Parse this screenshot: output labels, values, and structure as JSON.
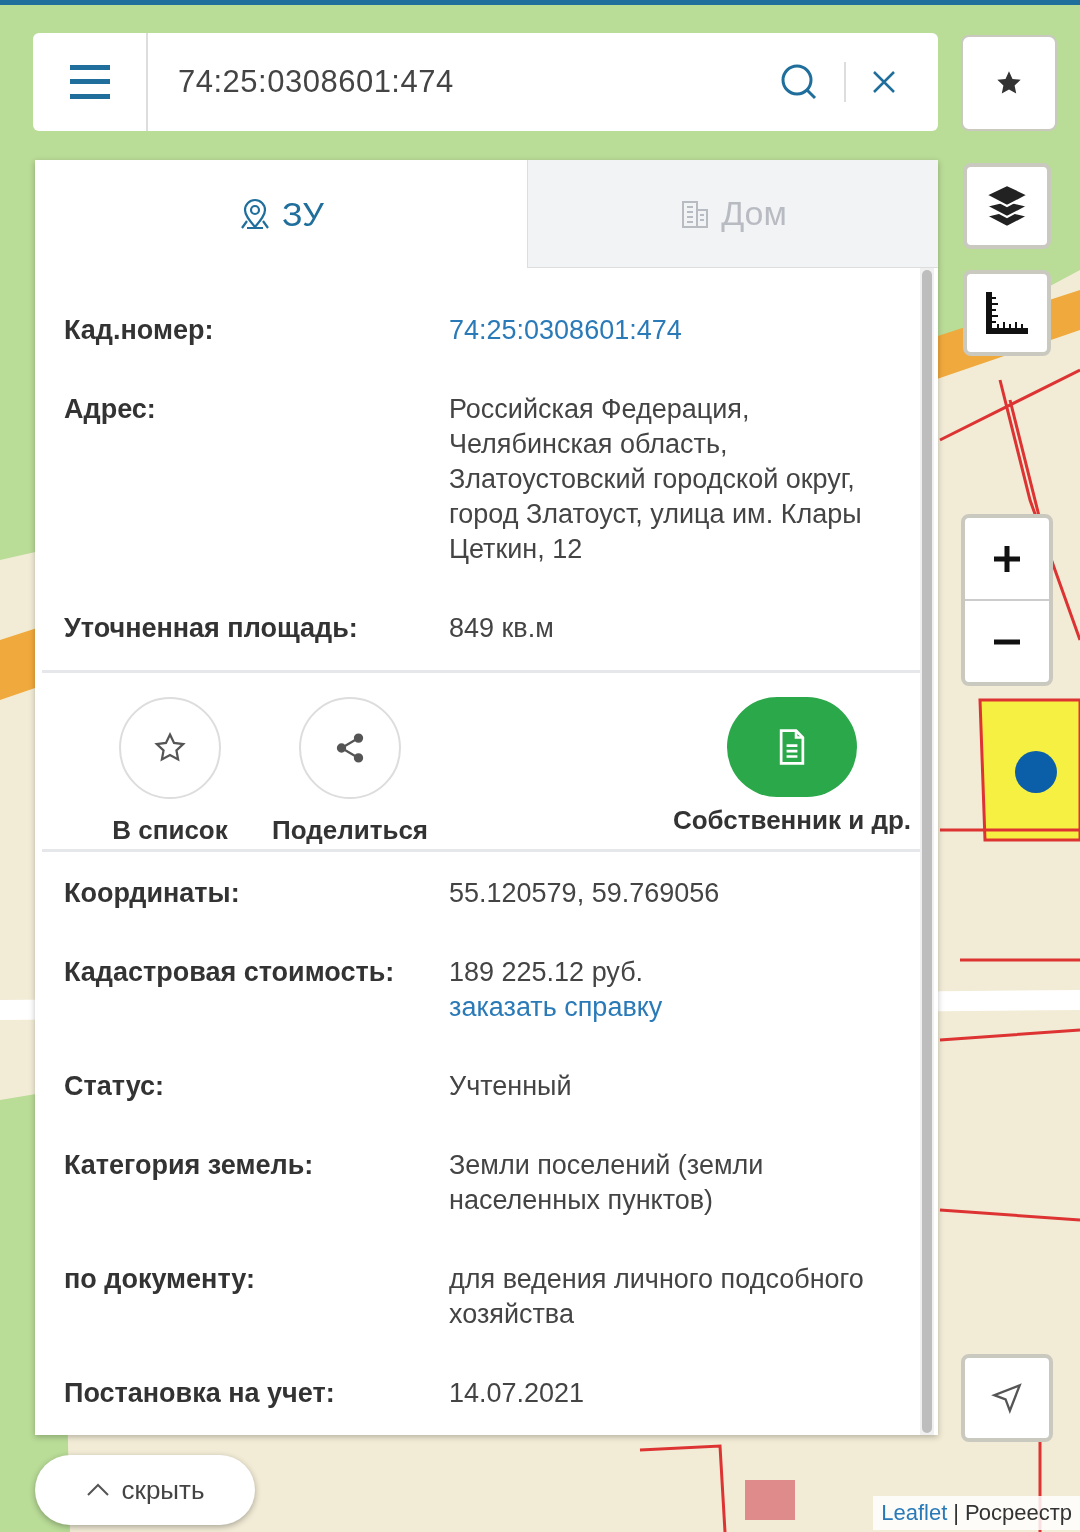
{
  "search": {
    "value": "74:25:0308601:474"
  },
  "tabs": [
    {
      "label": "ЗУ",
      "selected": true,
      "kind": "pin"
    },
    {
      "label": "Дом",
      "selected": false,
      "kind": "building"
    }
  ],
  "info_top": [
    {
      "label": "Кад.номер:",
      "value": "74:25:0308601:474",
      "kind": "link"
    },
    {
      "label": "Адрес:",
      "value": "Российская Федерация, Челябинская область, Златоустовский городской округ, город Златоуст, улица им. Клары Цеткин, 12",
      "kind": "text"
    },
    {
      "label": "Уточненная площадь:",
      "value": "849 кв.м",
      "kind": "text"
    }
  ],
  "actions": [
    {
      "label": "В список",
      "kind": "favorite"
    },
    {
      "label": "Поделиться",
      "kind": "share"
    },
    {
      "label": "Собственник и др.",
      "kind": "owner"
    }
  ],
  "info_bottom": [
    {
      "label": "Координаты:",
      "value": "55.120579, 59.769056"
    },
    {
      "label": "Кадастровая стоимость:",
      "value": "189 225.12 руб.",
      "link": "заказать справку"
    },
    {
      "label": "Статус:",
      "value": "Учтенный"
    },
    {
      "label": "Категория земель:",
      "value": "Земли поселений (земли населенных пунктов)"
    },
    {
      "label": "по документу:",
      "value": "для ведения личного подсобного хозяйства"
    },
    {
      "label": "Постановка на учет:",
      "value": "14.07.2021"
    }
  ],
  "hide_button": {
    "label": "скрыть"
  },
  "attribution": {
    "link": "Leaflet",
    "separator": "|",
    "source": "Росреестр"
  }
}
